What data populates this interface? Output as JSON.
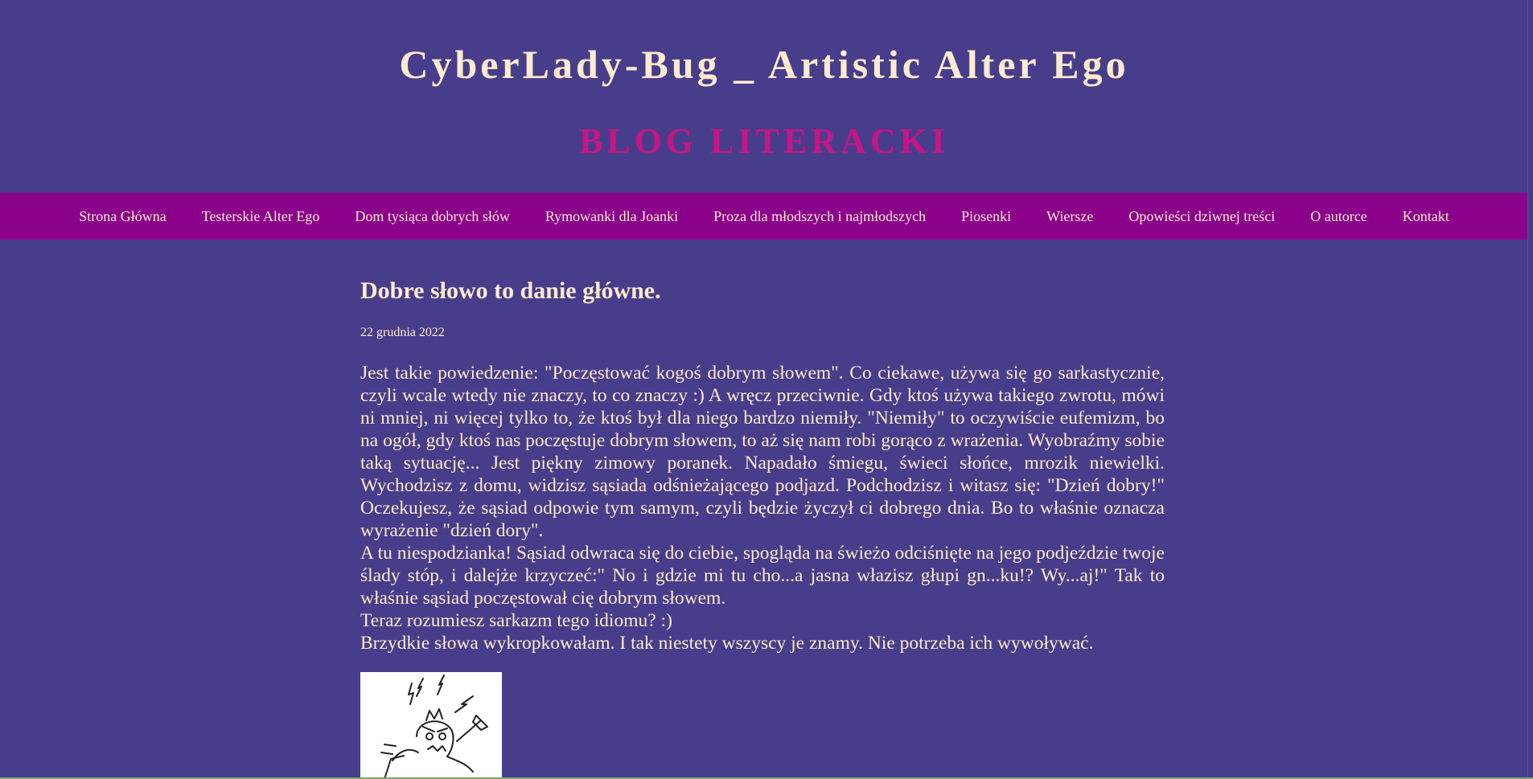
{
  "header": {
    "title": "CyberLady-Bug _ Artistic Alter Ego",
    "subtitle": "BLOG LITERACKI"
  },
  "nav": {
    "items": [
      "Strona Główna",
      "Testerskie Alter Ego",
      "Dom tysiąca dobrych słów",
      "Rymowanki dla Joanki",
      "Proza dla młodszych i najmłodszych",
      "Piosenki",
      "Wiersze",
      "Opowieści dziwnej treści",
      "O autorce",
      "Kontakt"
    ]
  },
  "post": {
    "title": "Dobre słowo to danie główne.",
    "date": "22 grudnia 2022",
    "paragraphs": [
      "Jest takie powiedzenie: \"Poczęstować kogoś dobrym słowem\". Co ciekawe, używa się go sarkastycznie, czyli wcale wtedy nie znaczy, to co znaczy :) A wręcz przeciwnie. Gdy ktoś używa takiego zwrotu, mówi ni mniej, ni więcej tylko to, że ktoś był dla niego bardzo niemiły. \"Niemiły\" to oczywiście eufemizm, bo na ogół, gdy ktoś nas poczęstuje dobrym słowem, to aż się nam robi gorąco z wrażenia. Wyobraźmy sobie taką sytuację... Jest piękny zimowy poranek. Napadało śmiegu, świeci słońce, mrozik niewielki. Wychodzisz z domu, widzisz sąsiada odśnieżającego podjazd. Podchodzisz i witasz się: \"Dzień dobry!\" Oczekujesz, że sąsiad odpowie tym samym, czyli będzie życzył ci dobrego dnia. Bo to właśnie oznacza wyrażenie \"dzień dory\".",
      "A tu niespodzianka! Sąsiad odwraca się do ciebie, spogląda na świeżo odciśnięte na jego podjeździe twoje ślady stóp, i dalejże krzyczeć:\" No i gdzie mi tu cho...a jasna włazisz głupi gn...ku!? Wy...aj!\" Tak to właśnie sąsiad poczęstował cię dobrym słowem.",
      "Teraz rozumiesz sarkazm tego idiomu? :)",
      "Brzydkie słowa wykropkowałam. I tak niestety wszyscy je znamy. Nie potrzeba ich wywoływać."
    ]
  },
  "colors": {
    "background": "#483d8b",
    "nav_background": "#8b008b",
    "title_text": "#fdebd0",
    "subtitle_text": "#c71585"
  }
}
